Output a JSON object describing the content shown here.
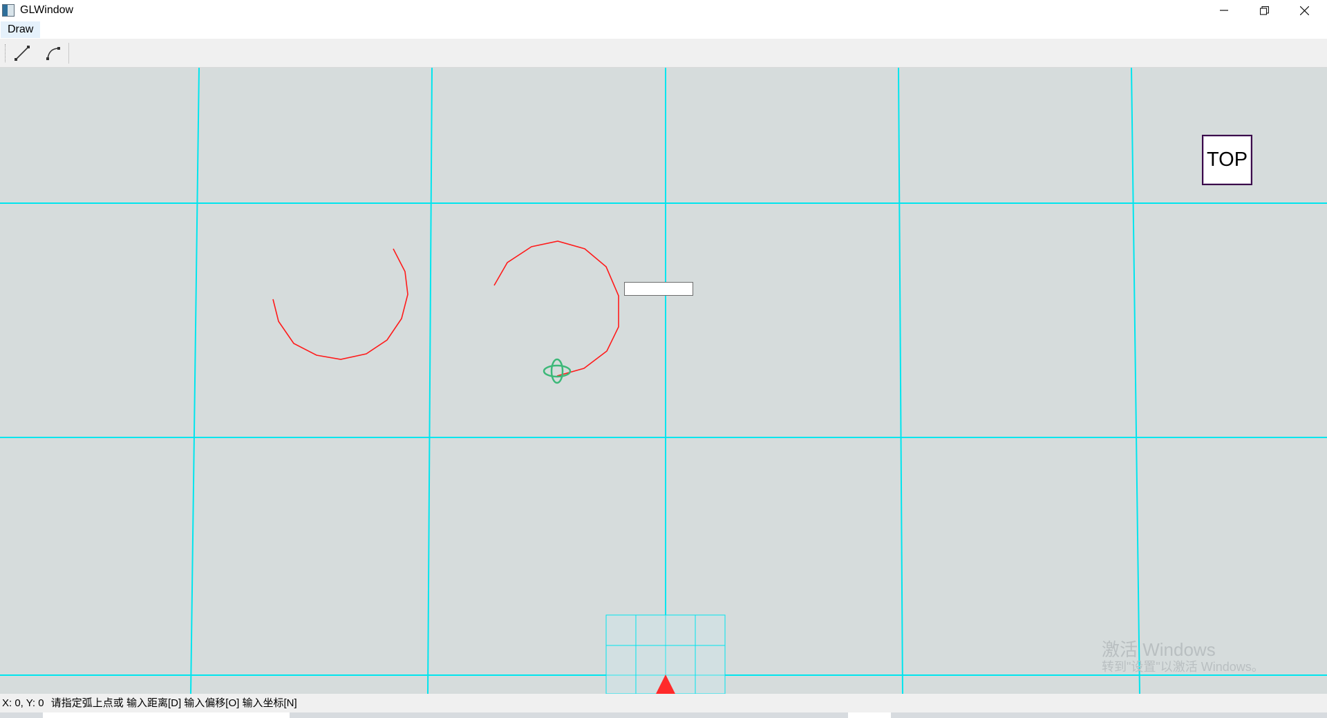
{
  "window": {
    "title": "GLWindow",
    "icon": "app-window-icon",
    "controls": [
      "minimize-icon",
      "restore-icon",
      "close-icon"
    ]
  },
  "menu": {
    "items": [
      {
        "label": "Draw"
      }
    ]
  },
  "toolbar": {
    "tools": [
      {
        "name": "line-tool",
        "icon": "line-icon"
      },
      {
        "name": "arc-tool",
        "icon": "arc-icon"
      }
    ]
  },
  "viewport": {
    "background": "#d6dcdc",
    "grid_color": "#00e5ee",
    "curve_color": "#ff1a1a",
    "cursor_color": "#3cb878",
    "view_label": "TOP",
    "coordinate_input": {
      "value": ""
    },
    "origin_marker": "red-triangle-axis-icon"
  },
  "watermark": {
    "line1": "激活 Windows",
    "line2": "转到\"设置\"以激活 Windows。"
  },
  "status": {
    "coords": "X: 0, Y: 0",
    "prompt": "请指定弧上点或 输入距离[D] 输入偏移[O] 输入坐标[N]"
  }
}
